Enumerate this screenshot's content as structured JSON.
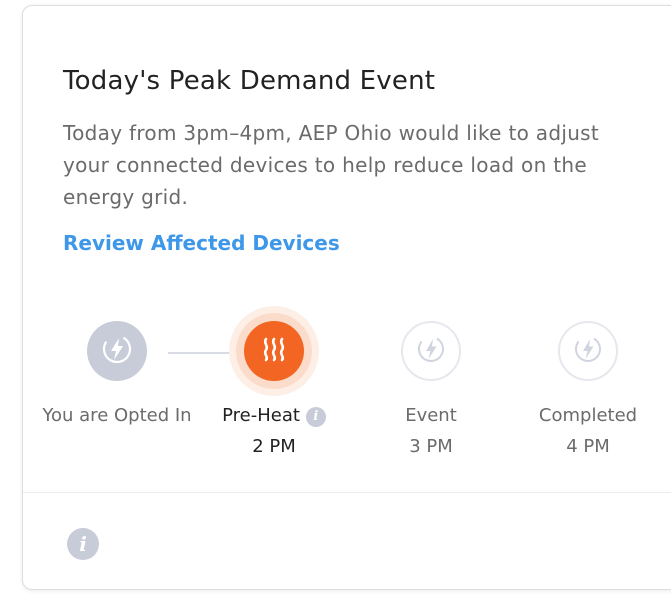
{
  "card": {
    "title": "Today's Peak Demand Event",
    "description": "Today from 3pm–4pm, AEP Ohio would like to adjust your connected devices to help reduce load on the energy grid.",
    "review_link": "Review Affected Devices"
  },
  "steps": [
    {
      "label": "You are Opted In",
      "time": "",
      "state": "done",
      "icon": "lightning-icon"
    },
    {
      "label": "Pre-Heat",
      "time": "2 PM",
      "state": "active",
      "icon": "heat-waves-icon"
    },
    {
      "label": "Event",
      "time": "3 PM",
      "state": "future",
      "icon": "lightning-icon"
    },
    {
      "label": "Completed",
      "time": "4 PM",
      "state": "future",
      "icon": "lightning-icon"
    }
  ],
  "colors": {
    "accent": "#f26522",
    "link": "#3e97e8",
    "muted_icon": "#c7ccd8"
  }
}
